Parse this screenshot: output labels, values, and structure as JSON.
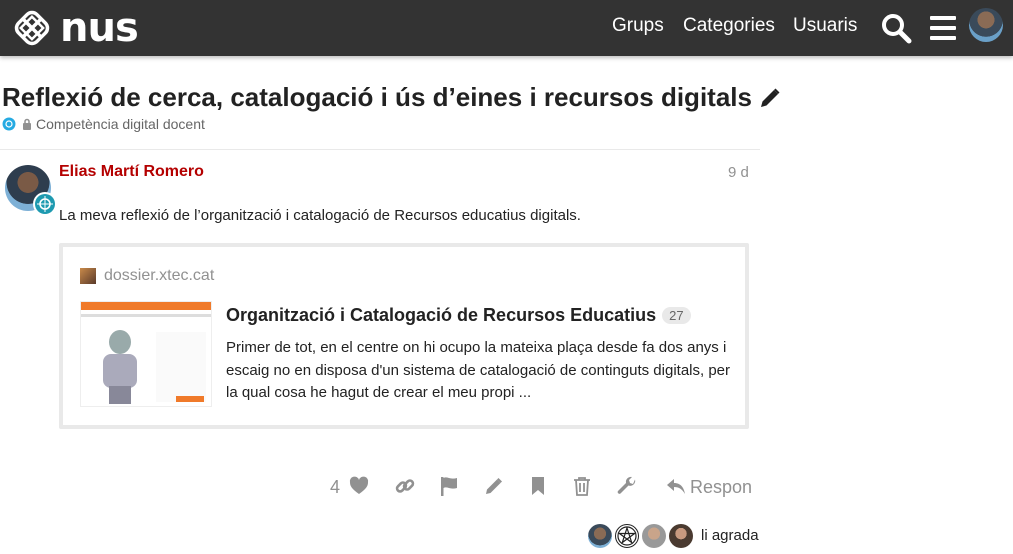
{
  "header": {
    "logo_text": "nus",
    "nav": [
      "Grups",
      "Categories",
      "Usuaris"
    ],
    "icons": [
      "search-icon",
      "hamburger-menu-icon",
      "user-avatar"
    ],
    "background": "#333333"
  },
  "topic": {
    "title": "Reflexió de cerca, catalogació i ús d’eines i recursos digitals",
    "category": "Competència digital docent",
    "category_color": "#25AAE2"
  },
  "post": {
    "username": "Elias Martí Romero",
    "username_color": "#B40000",
    "date": "9 d",
    "text": "La meva reflexió de l’organització i catalogació de Recursos educatius digitals.",
    "onebox": {
      "source": "dossier.xtec.cat",
      "title": "Organització i Catalogació de Recursos Educatius",
      "count": "27",
      "excerpt": "Primer de tot, en el centre on hi ocupo la mateixa plaça desde fa dos anys i escaig no en disposa d'un sistema de catalogació de continguts digitals, per la qual cosa he hagut de crear el meu propi ..."
    },
    "actions": {
      "like_count": "4",
      "reply_label": "Respon"
    },
    "likers_text": "li agrada"
  }
}
